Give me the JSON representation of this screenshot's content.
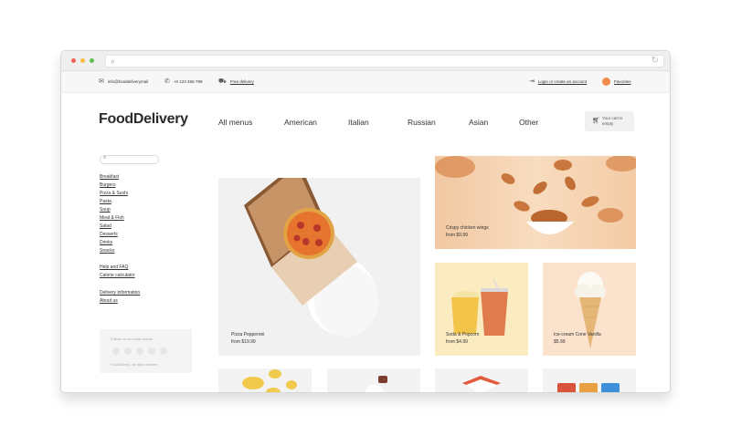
{
  "topbar": {
    "email": "info@fooddeliverymail",
    "phone": "+0 123 456-789",
    "delivery": "Free delivery",
    "login": "Login or create an account",
    "favorites": "Favorites"
  },
  "header": {
    "logo": "FoodDelivery",
    "nav": [
      "All menus",
      "American",
      "Italian",
      "Russian",
      "Asian",
      "Other"
    ],
    "cart": "Your cart is empty"
  },
  "sidebar": {
    "categories": [
      "Breakfast",
      "Burgers",
      "Pizza & Sushi",
      "Pasta",
      "Soup",
      "Meat & Fish",
      "Salad",
      "Desserts",
      "Drinks",
      "Snacks"
    ],
    "help": [
      "Help and FAQ",
      "Calorie calculator"
    ],
    "info": [
      "Delivery information",
      "About us"
    ],
    "social_title": "Follow us on social media",
    "social_footer": "FoodDelivery - all rights reserved"
  },
  "products": {
    "pizza": {
      "name": "Pizza Pepperoni",
      "price": "from $19.99"
    },
    "wings": {
      "name": "Crispy chicken wings",
      "price": "from $9.99"
    },
    "soda": {
      "name": "Soda & Popcorn",
      "price": "from $4.99"
    },
    "icecream": {
      "name": "Ice-cream Cone Vanilla",
      "price": "$5.99"
    }
  },
  "colors": {
    "accent": "#f28c4b",
    "soda_bg": "#fbebc0",
    "icecream_bg": "#fbe2cc"
  }
}
